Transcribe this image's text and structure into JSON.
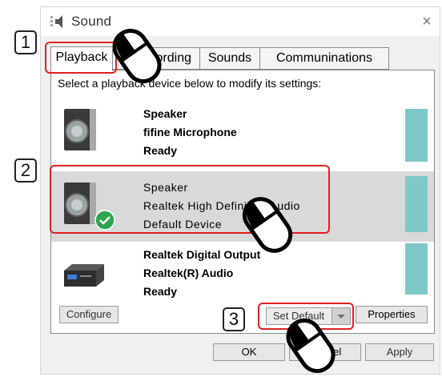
{
  "window": {
    "title": "Sound",
    "close_glyph": "×"
  },
  "tabs": [
    {
      "label": "Playback"
    },
    {
      "label": "Recording"
    },
    {
      "label": "Sounds"
    },
    {
      "label": "Communinations"
    }
  ],
  "instructions": "Select a playback device below to modify its settings:",
  "devices": [
    {
      "name": "Speaker",
      "description": "fifine Microphone",
      "status": "Ready",
      "icon": "speaker-icon"
    },
    {
      "name": "Speaker",
      "description": "Realtek High Definition Audio",
      "status": "Default Device",
      "icon": "speaker-icon",
      "default": true
    },
    {
      "name": "Realtek Digital Output",
      "description": "Realtek(R) Audio",
      "status": "Ready",
      "icon": "receiver-icon"
    }
  ],
  "buttons": {
    "configure": "Configure",
    "set_default": "Set Default",
    "properties": "Properties",
    "ok": "OK",
    "cancel": "Cancel",
    "apply": "Apply"
  },
  "callouts": [
    "1",
    "2",
    "3"
  ],
  "colors": {
    "highlight": "#e02020",
    "level_meter": "#7fc8c8",
    "check": "#2ea44f"
  }
}
